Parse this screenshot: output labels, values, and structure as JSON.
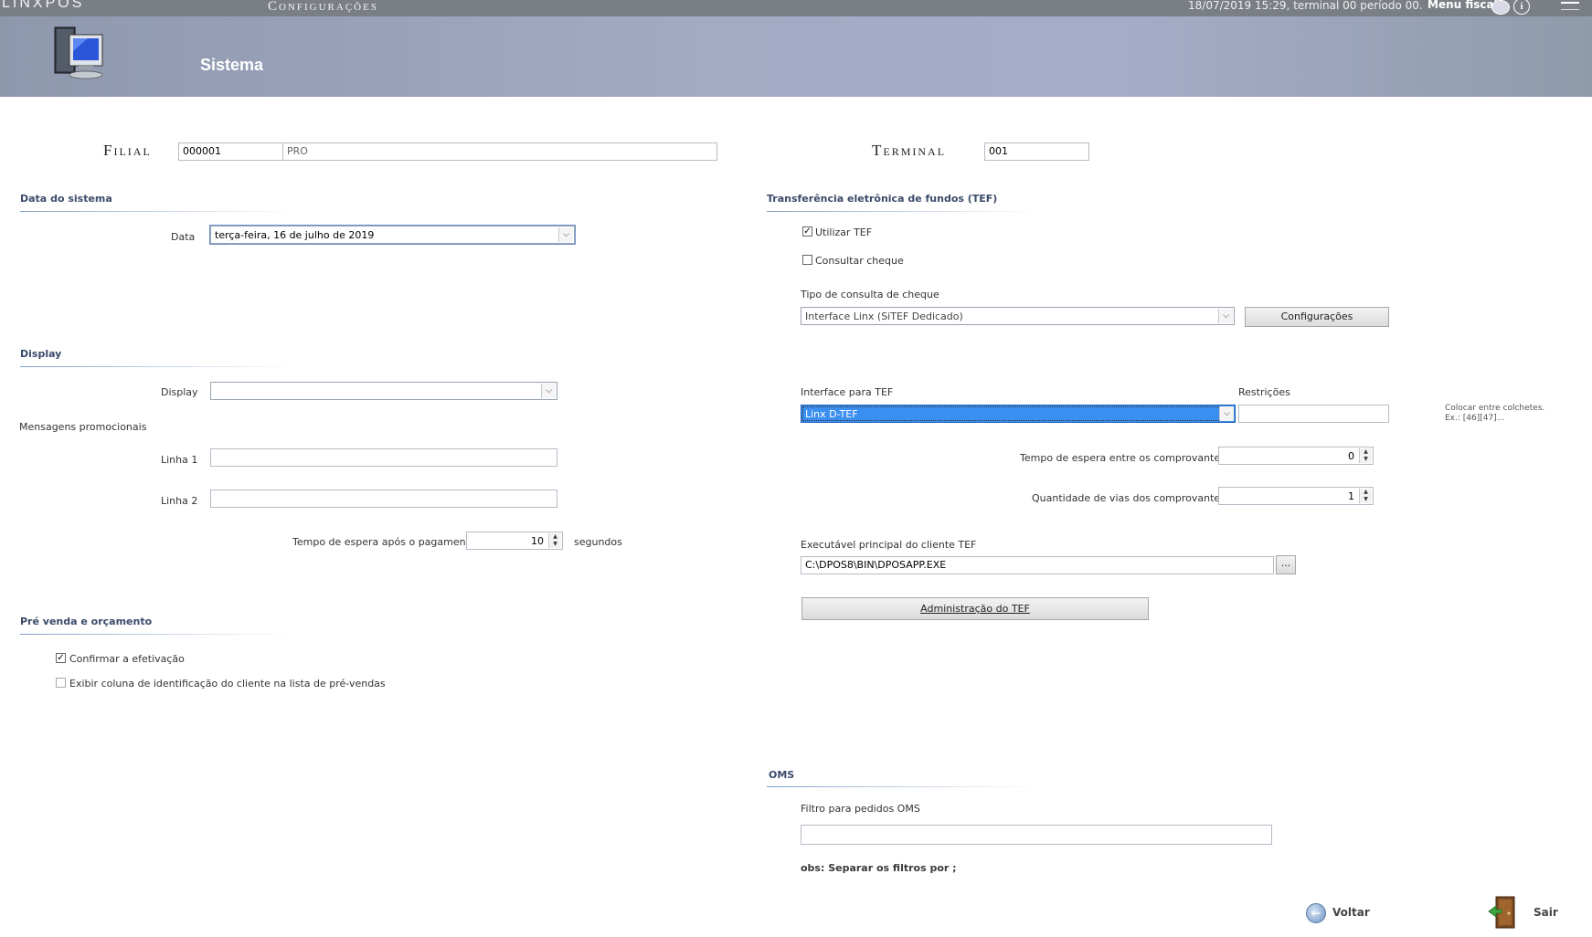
{
  "topbar": {
    "logo": "LINXPOS",
    "title": "Configurações",
    "status": "18/07/2019 15:29, terminal 00   período 00.",
    "menu_fiscal": "Menu fiscal",
    "info_glyph": "i"
  },
  "header": {
    "title": "Sistema"
  },
  "filial": {
    "label": "Filial",
    "code": "000001",
    "name": "PRO"
  },
  "terminal": {
    "label": "Terminal",
    "value": "001"
  },
  "data_sistema": {
    "section": "Data do sistema",
    "data_label": "Data",
    "data_value": "terça-feira, 16 de julho de 2019"
  },
  "display": {
    "section": "Display",
    "display_label": "Display",
    "display_value": "",
    "mensagens": "Mensagens promocionais",
    "linha1_label": "Linha 1",
    "linha1_value": "",
    "linha2_label": "Linha 2",
    "linha2_value": "",
    "tempo_label": "Tempo de espera após o pagamento",
    "tempo_value": "10",
    "tempo_unit": "segundos"
  },
  "prevenda": {
    "section": "Pré venda e orçamento",
    "confirmar_label": "Confirmar a efetivação",
    "confirmar_checked": true,
    "exibir_label": "Exibir coluna de identificação do cliente na lista de pré-vendas",
    "exibir_checked": false
  },
  "tef": {
    "section": "Transferência eletrônica de fundos (TEF)",
    "utilizar_label": "Utilizar TEF",
    "utilizar_checked": true,
    "consultar_label": "Consultar cheque",
    "consultar_checked": false,
    "tipo_label": "Tipo de consulta de cheque",
    "tipo_value": "Interface Linx (SiTEF Dedicado)",
    "config_button": "Configurações",
    "interface_label": "Interface para TEF",
    "interface_value": "Linx D-TEF",
    "restricoes_label": "Restrições",
    "restricoes_value": "",
    "restricoes_hint1": "Colocar entre colchetes.",
    "restricoes_hint2": "Ex.: [46][47]...",
    "espera_label": "Tempo de espera entre os comprovantes",
    "espera_value": "0",
    "vias_label": "Quantidade de vias dos comprovantes",
    "vias_value": "1",
    "exe_label": "Executável principal do cliente TEF",
    "exe_value": "C:\\DPOS8\\BIN\\DPOSAPP.EXE",
    "browse_button": "...",
    "admin_button": "Administração do TEF"
  },
  "oms": {
    "section": "OMS",
    "filtro_label": "Filtro para pedidos OMS",
    "filtro_value": "",
    "obs": "obs: Separar os filtros por ;"
  },
  "footer": {
    "voltar": "Voltar",
    "sair": "Sair"
  },
  "icons": {
    "chat": "chat-icon",
    "info": "info-icon",
    "minimize": "minimize-icon",
    "computer": "computer-icon",
    "back": "back-arrow-icon",
    "exit": "door-exit-icon"
  }
}
